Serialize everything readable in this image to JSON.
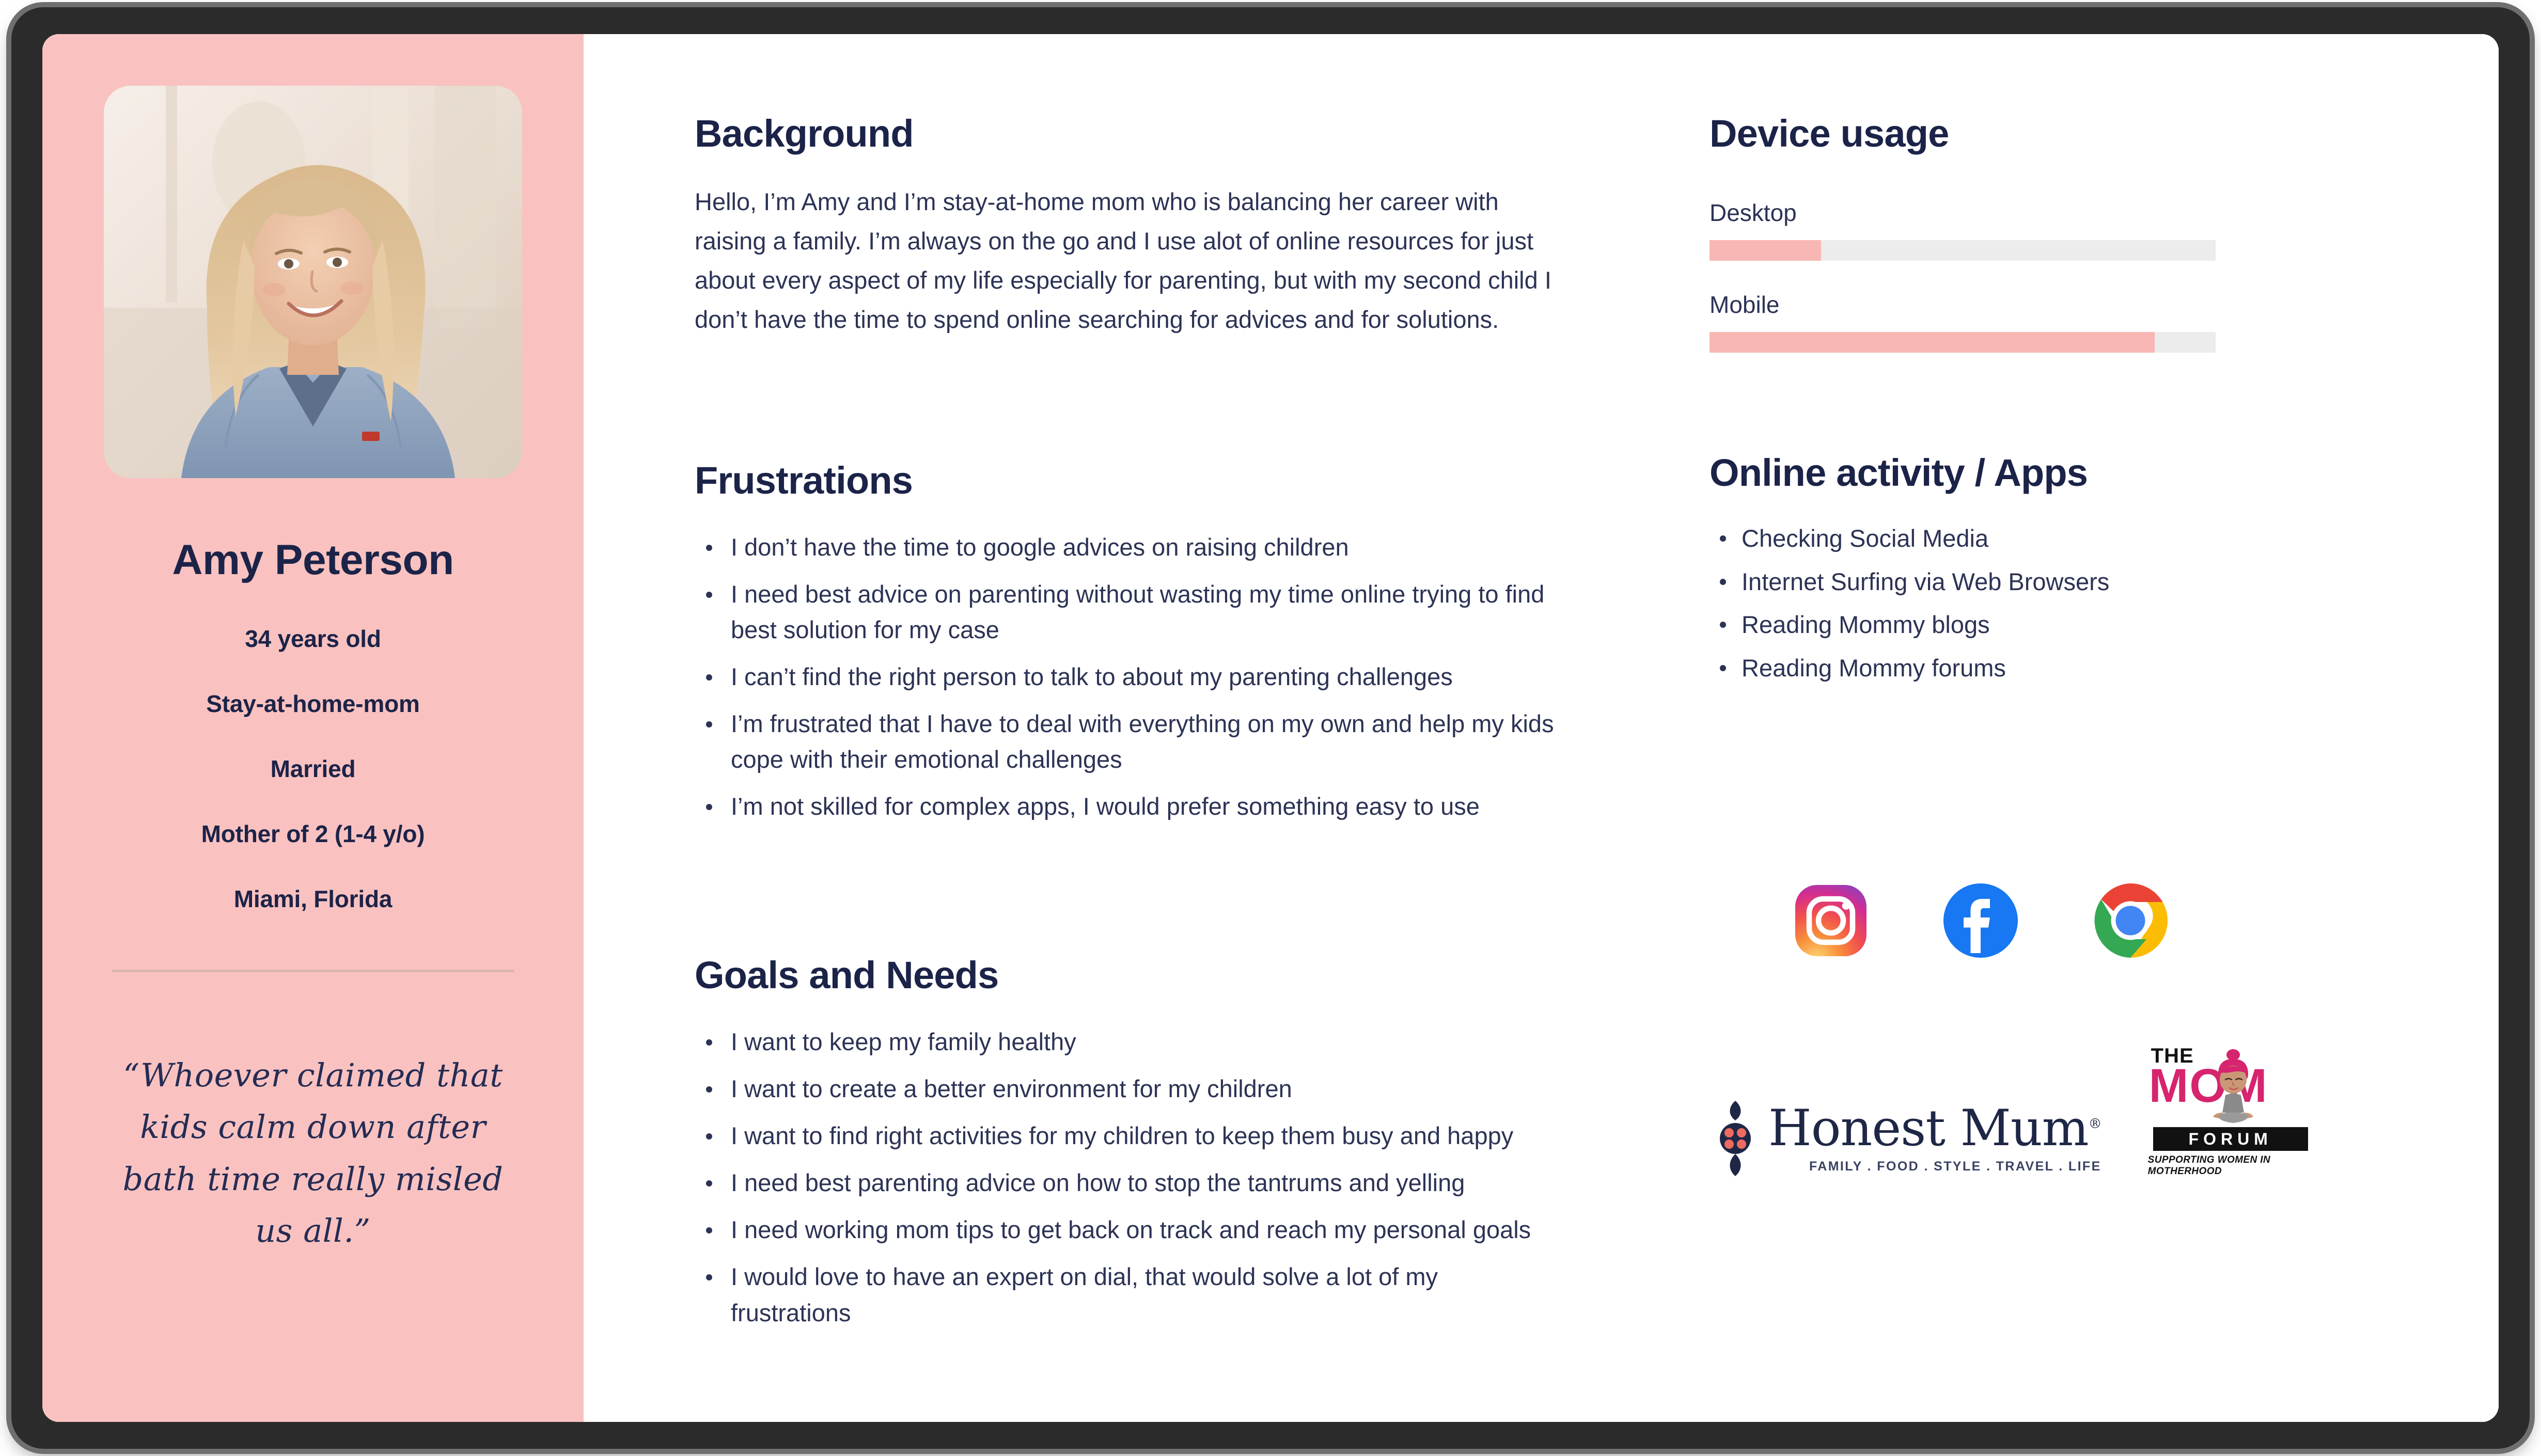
{
  "persona": {
    "name": "Amy Peterson",
    "avatar_alt": "photo-of-smiling-blonde-woman-in-denim-jacket",
    "facts": [
      "34 years old",
      "Stay-at-home-mom",
      "Married",
      "Mother of 2 (1-4 y/o)",
      "Miami, Florida"
    ],
    "quote": "“Whoever claimed that kids calm down after bath time really misled us all.”"
  },
  "background": {
    "title": "Background",
    "text": "Hello, I’m Amy and I’m stay-at-home mom who is balancing her career with raising a family. I’m always on the go and I use alot of online resources for just about every aspect of my life especially for parenting, but with my second child I don’t have the time to spend online searching for advices and for solutions."
  },
  "frustrations": {
    "title": "Frustrations",
    "items": [
      "I don’t have the time to google advices on raising children",
      "I need best advice on parenting without wasting my time online trying to find best solution for my case",
      "I can’t find the right person to talk to about my parenting challenges",
      "I’m frustrated that I have to deal with everything on my own and help my kids cope with their emotional challenges",
      "I’m not skilled for complex apps, I would prefer something easy to use"
    ]
  },
  "goals": {
    "title": "Goals and Needs",
    "items": [
      "I want to keep my family healthy",
      "I want to create a better environment for my children",
      "I want to find right activities for my children to keep them busy and happy",
      "I need best parenting advice on how to stop the tantrums and yelling",
      "I need working mom tips to get back on track and reach my personal goals",
      "I would love to have an expert on dial, that would solve a lot of my frustrations"
    ]
  },
  "device_usage": {
    "title": "Device usage",
    "bars": [
      {
        "label": "Desktop",
        "percent": 22
      },
      {
        "label": "Mobile",
        "percent": 88
      }
    ]
  },
  "online_activity": {
    "title": "Online activity / Apps",
    "items": [
      "Checking Social Media",
      "Internet Surfing via Web Browsers",
      "Reading Mommy blogs",
      "Reading Mommy forums"
    ]
  },
  "app_icons": [
    {
      "name": "instagram-icon",
      "label": "Instagram"
    },
    {
      "name": "facebook-icon",
      "label": "Facebook"
    },
    {
      "name": "chrome-icon",
      "label": "Google Chrome"
    }
  ],
  "brand_logos": {
    "honest_mum": {
      "word": "Honest Mum",
      "registered": "®",
      "tagline": "FAMILY . FOOD . STYLE . TRAVEL . LIFE"
    },
    "mom_forum": {
      "the": "THE",
      "mom": "MOM",
      "forum": "FORUM",
      "tagline": "SUPPORTING WOMEN IN MOTHERHOOD"
    }
  },
  "colors": {
    "sidebar_pink": "#F9C2C0",
    "bar_fill_pink": "#F8B7B4",
    "bar_track_gray": "#ECECEC",
    "heading_navy": "#1C2348",
    "body_navy": "#2C3355"
  }
}
